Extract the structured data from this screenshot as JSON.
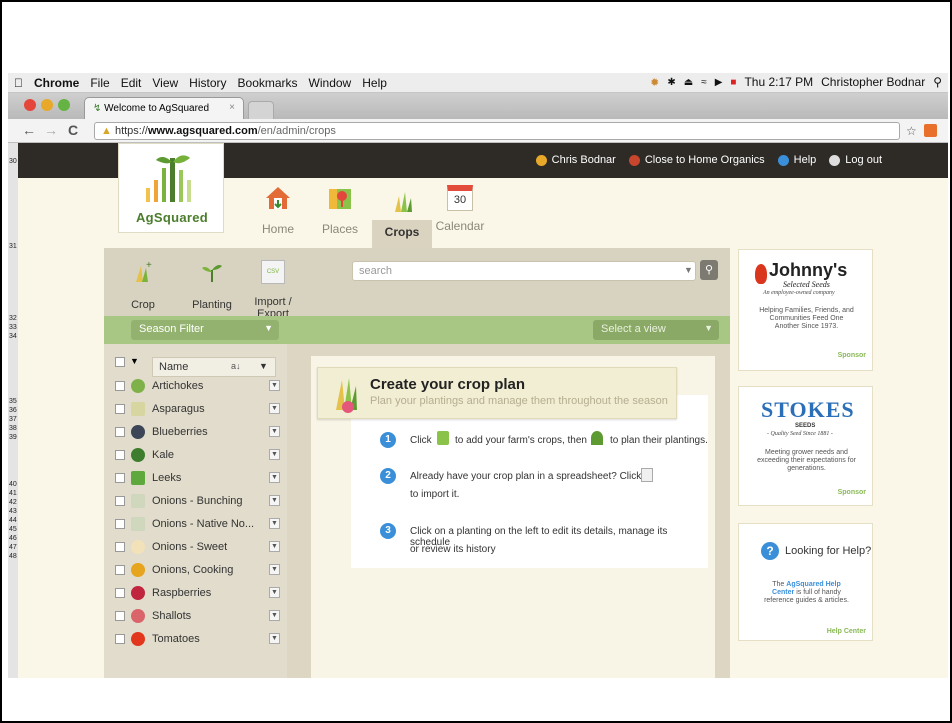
{
  "menubar": {
    "app": "Chrome",
    "items": [
      "File",
      "Edit",
      "View",
      "History",
      "Bookmarks",
      "Window",
      "Help"
    ],
    "clock": "Thu 2:17 PM",
    "user": "Christopher Bodnar"
  },
  "browser": {
    "tab_title": "Welcome to AgSquared",
    "url_scheme": "https://",
    "url_host": "www.agsquared.com",
    "url_path": "/en/admin/crops"
  },
  "dock_numbers": [
    "30",
    "31",
    "32",
    "33",
    "34",
    "35",
    "36",
    "37",
    "38",
    "39",
    "40",
    "41",
    "42",
    "43",
    "44",
    "45",
    "46",
    "47",
    "48"
  ],
  "topbar": {
    "user": "Chris Bodnar",
    "farm": "Close to Home Organics",
    "help": "Help",
    "logout": "Log out"
  },
  "logo": {
    "name": "AgSquared"
  },
  "nav": {
    "home": "Home",
    "places": "Places",
    "crops": "Crops",
    "calendar": "Calendar",
    "calendar_day": "30"
  },
  "tools": {
    "crop": "Crop",
    "planting": "Planting",
    "import_export": "Import / Export",
    "csv": "CSV"
  },
  "search": {
    "placeholder": "search"
  },
  "filters": {
    "season": "Season Filter",
    "view": "Select a view"
  },
  "list": {
    "column": "Name",
    "sort": "a↓",
    "crops": [
      "Artichokes",
      "Asparagus",
      "Blueberries",
      "Kale",
      "Leeks",
      "Onions - Bunching",
      "Onions - Native No...",
      "Onions - Sweet",
      "Onions, Cooking",
      "Raspberries",
      "Shallots",
      "Tomatoes"
    ]
  },
  "plan": {
    "title": "Create your crop plan",
    "subtitle": "Plan your plantings and manage them throughout the season",
    "step1_a": "Click",
    "step1_b": "to add your farm's crops, then",
    "step1_c": "to plan their plantings.",
    "step2_a": "Already have your crop plan in a spreadsheet? Click",
    "step2_b": "to import it.",
    "step3_a": "Click on a planting on the left to edit its details, manage its schedule",
    "step3_b": "or review its history"
  },
  "ads": {
    "johnnys": "Johnny's",
    "johnnys_sub": "Selected Seeds",
    "johnnys_tag": "An employee-owned company",
    "johnnys_body": "Helping Families, Friends, and Communities Feed One Another Since 1973.",
    "sponsor": "Sponsor",
    "stokes": "STOKES",
    "stokes_seeds": "SEEDS",
    "stokes_tag": "- Quality Seed Since 1881 -",
    "stokes_body": "Meeting grower needs and exceeding their expectations for generations.",
    "help_title": "Looking for Help?",
    "help_body_a": "The",
    "help_link": "AgSquared Help Center",
    "help_body_b": "is full of handy reference guides & articles.",
    "help_center": "Help Center"
  }
}
